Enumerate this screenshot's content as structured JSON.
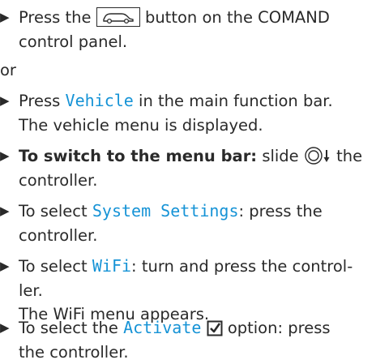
{
  "steps": [
    {
      "marker": "▶",
      "before": "Press the",
      "icon": "vehicle-button-icon",
      "after": "button on the COMAND",
      "line2": "control panel."
    },
    {
      "connector": "or"
    },
    {
      "marker": "▶",
      "text1_a": "Press",
      "text1_display": "Vehicle",
      "text1_b": "in the main function bar.",
      "line2": "The vehicle menu is displayed."
    },
    {
      "marker": "▶",
      "heading": "To switch to the menu bar:",
      "text_a": "slide",
      "icon": "controller-slide-down-icon",
      "text_b": "the",
      "line2": "controller."
    },
    {
      "marker": "▶",
      "text_a": "To select",
      "display": "System Settings",
      "text_b": ": press the",
      "line2": "controller."
    },
    {
      "marker": "▶",
      "text_a": "To select",
      "display": "WiFi",
      "text_b": ": turn and press the control-",
      "line2": "ler.",
      "line3": "The WiFi menu appears."
    },
    {
      "marker": "▶",
      "text_a": "To select the",
      "display": "Activate",
      "icon": "checkbox-checked-icon",
      "text_b": "option: press",
      "line2": "the controller."
    }
  ],
  "colors": {
    "text": "#2a2a2a",
    "display": "#1693d6"
  }
}
